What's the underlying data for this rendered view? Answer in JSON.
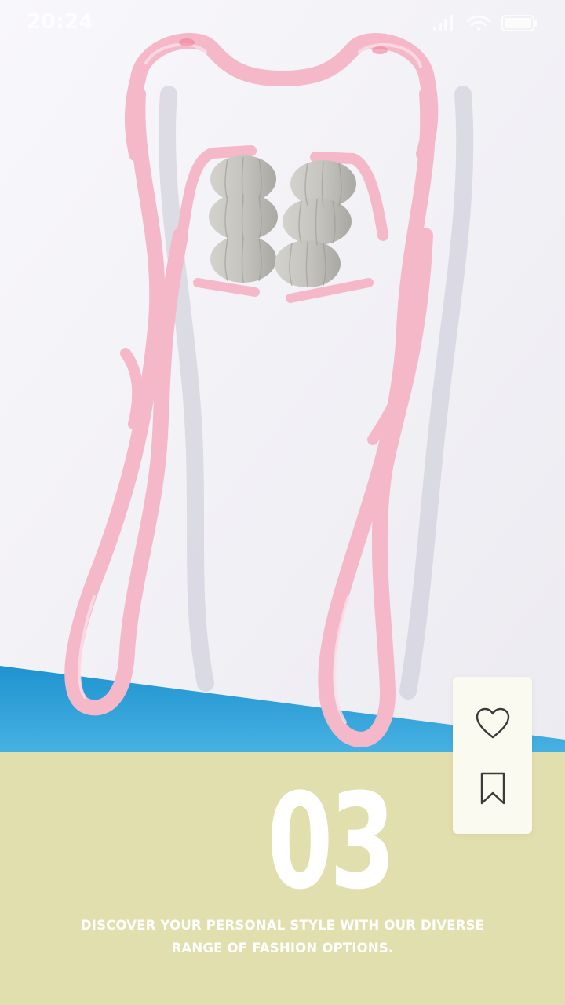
{
  "status_bar": {
    "time": "20:24",
    "icons": [
      "signal-icon",
      "wifi-icon",
      "battery-icon"
    ]
  },
  "product_image": {
    "subject": "pink neck massager with grey rollers"
  },
  "actions": {
    "like_icon": "heart-icon",
    "bookmark_icon": "bookmark-icon"
  },
  "slide": {
    "number": "03",
    "tagline": "DISCOVER YOUR PERSONAL STYLE WITH OUR DIVERSE RANGE OF FASHION OPTIONS."
  },
  "colors": {
    "panel_background": "#e2dfae",
    "card_background": "#fbfaf0",
    "text": "#ffffff",
    "product_pink": "#f4b8c9",
    "floor_blue": "#2d9fd6"
  }
}
